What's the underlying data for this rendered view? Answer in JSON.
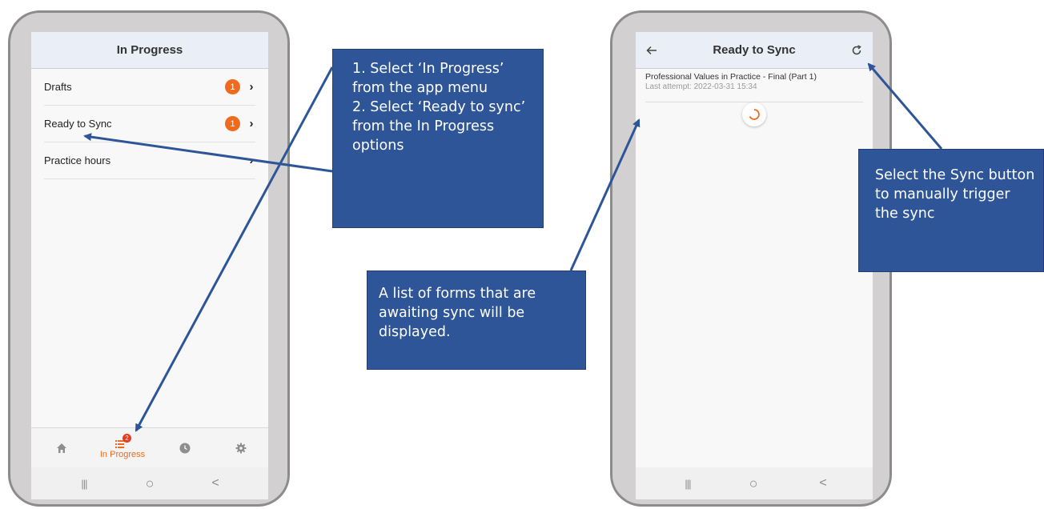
{
  "colors": {
    "accent": "#f06a1d",
    "callout_bg": "#2e5597",
    "header_bg": "#e9eef7"
  },
  "left_phone": {
    "header_title": "In Progress",
    "menu_items": [
      {
        "label": "Drafts",
        "badge": "1"
      },
      {
        "label": "Ready to Sync",
        "badge": "1"
      },
      {
        "label": "Practice hours",
        "badge": ""
      }
    ],
    "tabbar": {
      "home_icon": "home-icon",
      "in_progress_icon": "list-icon",
      "in_progress_badge": "2",
      "in_progress_label": "In Progress",
      "history_icon": "clock-icon",
      "settings_icon": "gear-icon"
    },
    "nav": {
      "recent": "|||",
      "home": "○",
      "back": "<"
    }
  },
  "right_phone": {
    "header_title": "Ready to Sync",
    "back_icon": "back-arrow-icon",
    "sync_icon": "sync-icon",
    "list": [
      {
        "title": "Professional Values in Practice - Final (Part 1)",
        "subtitle": "Last attempt: 2022-03-31 15:34"
      }
    ],
    "nav": {
      "recent": "|||",
      "home": "○",
      "back": "<"
    }
  },
  "callouts": {
    "steps": "1. Select ‘In Progress’ from the app menu\n2. Select ‘Ready to sync’ from the In Progress options",
    "list_info": "A list of forms that are awaiting sync will be displayed.",
    "sync_info": "Select the Sync button to manually trigger the sync"
  }
}
